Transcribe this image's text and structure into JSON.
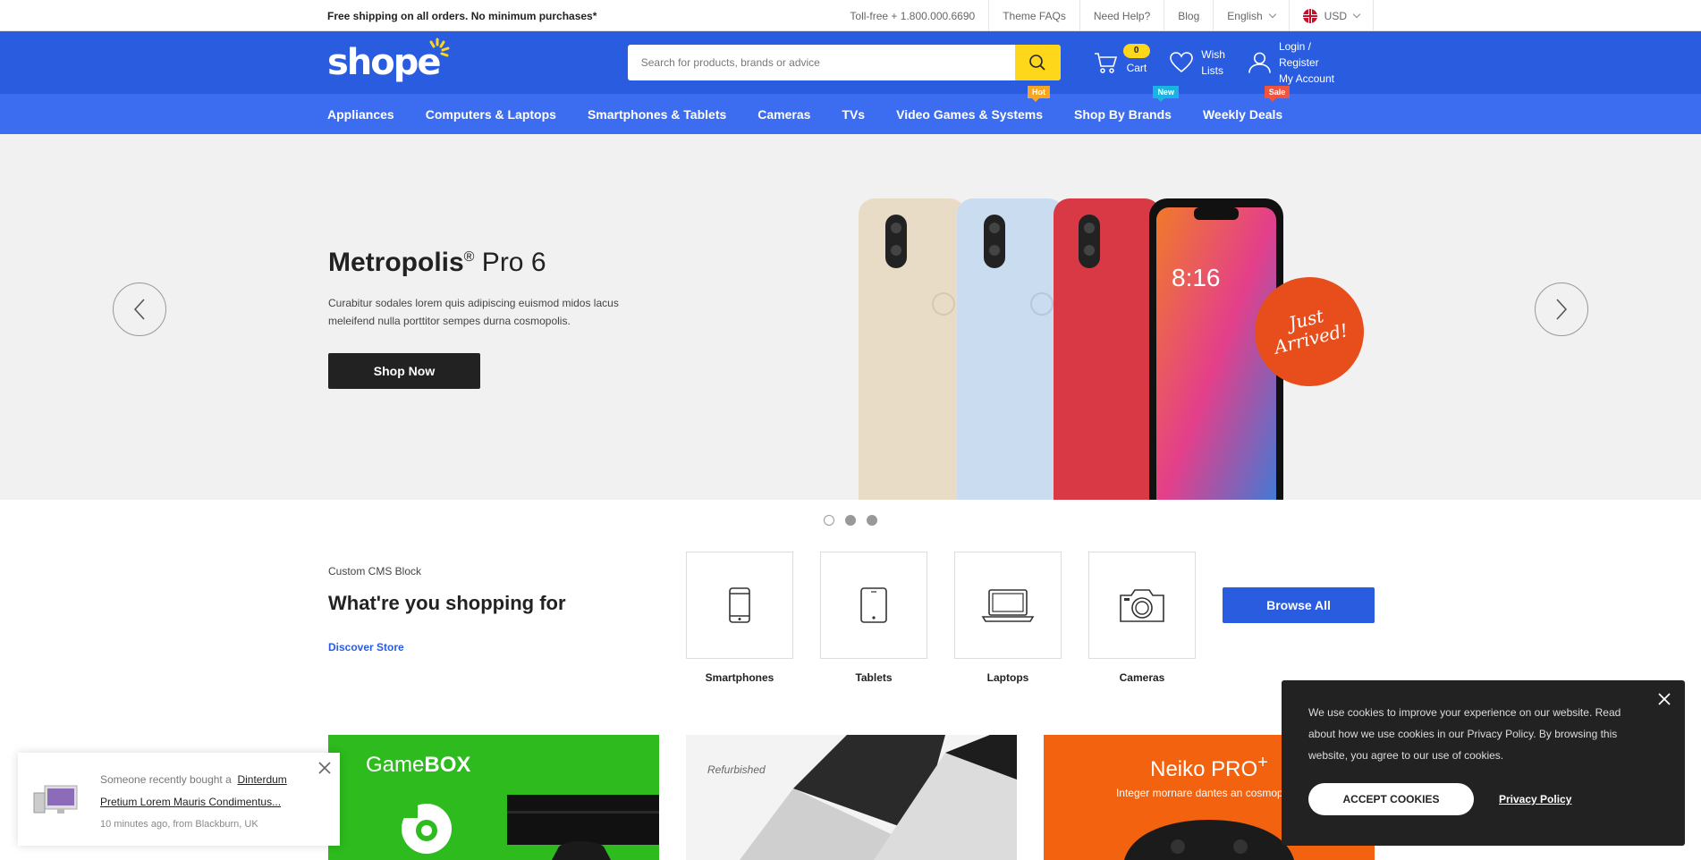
{
  "topbar": {
    "promo": "Free shipping on all orders. No minimum purchases*",
    "tollfree": "Toll-free + 1.800.000.6690",
    "faqs": "Theme FAQs",
    "help": "Need Help?",
    "blog": "Blog",
    "language": "English",
    "currency": "USD"
  },
  "header": {
    "logo": "shope",
    "search_placeholder": "Search for products, brands or advice",
    "cart_count": "0",
    "cart_label": "Cart",
    "wish_line1": "Wish",
    "wish_line2": "Lists",
    "account_line1": "Login / Register",
    "account_line2": "My Account"
  },
  "nav": {
    "items": [
      {
        "label": "Appliances"
      },
      {
        "label": "Computers & Laptops"
      },
      {
        "label": "Smartphones & Tablets"
      },
      {
        "label": "Cameras"
      },
      {
        "label": "TVs"
      },
      {
        "label": "Video Games & Systems",
        "badge": "Hot",
        "badge_color": "#f6a623"
      },
      {
        "label": "Shop By Brands",
        "badge": "New",
        "badge_color": "#19b5e0"
      },
      {
        "label": "Weekly Deals",
        "badge": "Sale",
        "badge_color": "#f0533e"
      }
    ]
  },
  "hero": {
    "title_bold": "Metropolis",
    "title_reg": "®",
    "title_rest": " Pro 6",
    "description": "Curabitur sodales lorem quis adipiscing euismod midos lacus meleifend nulla porttitor sempes durna cosmopolis.",
    "button": "Shop Now",
    "sticker_line1": "Just",
    "sticker_line2": "Arrived!",
    "slides": 3,
    "active_slide": 2
  },
  "cms": {
    "small": "Custom CMS Block",
    "heading": "What're you shopping for",
    "discover": "Discover Store",
    "categories": [
      {
        "label": "Smartphones",
        "icon": "smartphone-icon"
      },
      {
        "label": "Tablets",
        "icon": "tablet-icon"
      },
      {
        "label": "Laptops",
        "icon": "laptop-icon"
      },
      {
        "label": "Cameras",
        "icon": "camera-icon"
      }
    ],
    "browse_all": "Browse All"
  },
  "banners": {
    "b1_title_light": "Game",
    "b1_title_bold": "BOX",
    "b2_tag": "Refurbished",
    "b3_title": "Neiko PRO",
    "b3_title_sup": "+",
    "b3_sub": "Integer mornare dantes an cosmopolis."
  },
  "recent": {
    "prefix": "Someone recently bought a",
    "product": "Dinterdum Pretium Lorem Mauris Condimentus...",
    "time": "10 minutes ago, from Blackburn, UK"
  },
  "cookie": {
    "text": "We use cookies to improve your experience on our website. Read about how we use cookies in our Privacy Policy. By browsing this website, you agree to our use of cookies.",
    "accept": "ACCEPT COOKIES",
    "privacy": "Privacy Policy"
  },
  "colors": {
    "header_blue": "#2a5ce0",
    "nav_blue": "#3c6df0",
    "search_button": "#fed71a",
    "cookie_bg": "#222222"
  }
}
